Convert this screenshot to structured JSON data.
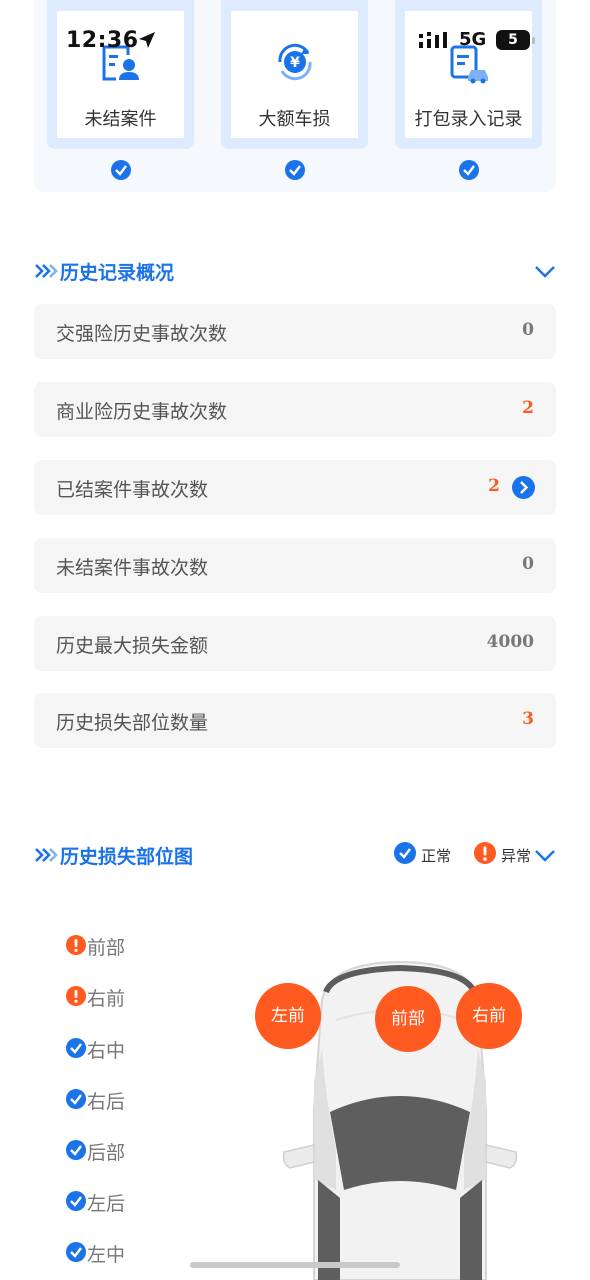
{
  "status_bar": {
    "time": "12:36",
    "network": "5G",
    "battery": "5"
  },
  "features": [
    {
      "label": "未结案件",
      "icon": "document-user-icon",
      "checked": true
    },
    {
      "label": "大额车损",
      "icon": "yen-refresh-icon",
      "checked": true
    },
    {
      "label": "打包录入记录",
      "icon": "car-record-icon",
      "checked": true
    }
  ],
  "history_section": {
    "title": "历史记录概况",
    "rows": [
      {
        "label": "交强险历史事故次数",
        "value": "0",
        "alert": false
      },
      {
        "label": "商业险历史事故次数",
        "value": "2",
        "alert": true
      },
      {
        "label": "已结案件事故次数",
        "value": "2",
        "alert": true,
        "has_arrow": true
      },
      {
        "label": "未结案件事故次数",
        "value": "0",
        "alert": false
      },
      {
        "label": "历史最大损失金额",
        "value": "4000",
        "alert": false
      },
      {
        "label": "历史损失部位数量",
        "value": "3",
        "alert": true
      }
    ]
  },
  "damage_section": {
    "title": "历史损失部位图",
    "legend": {
      "normal": "正常",
      "abnormal": "异常"
    },
    "parts": [
      {
        "label": "前部",
        "status": "abnormal"
      },
      {
        "label": "右前",
        "status": "abnormal"
      },
      {
        "label": "右中",
        "status": "normal"
      },
      {
        "label": "右后",
        "status": "normal"
      },
      {
        "label": "后部",
        "status": "normal"
      },
      {
        "label": "左后",
        "status": "normal"
      },
      {
        "label": "左中",
        "status": "normal"
      }
    ],
    "bubbles": {
      "left_front": "左前",
      "front": "前部",
      "right_front": "右前"
    }
  },
  "colors": {
    "accent": "#1a73e8",
    "alert": "#ff5a1f",
    "card_bg": "#deeafd",
    "row_bg": "#f5f5f5"
  }
}
